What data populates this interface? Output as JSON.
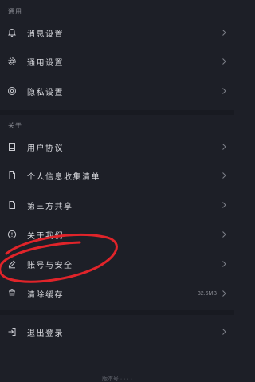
{
  "sections": {
    "general_header": "通用",
    "about_header": "关于"
  },
  "rows": {
    "message_settings": "消息设置",
    "general_settings": "通用设置",
    "privacy_settings": "隐私设置",
    "user_agreement": "用户协议",
    "personal_info_list": "个人信息收集清单",
    "third_party_sharing": "第三方共享",
    "about_us": "关于我们",
    "profile_manage": "账号与安全",
    "clear_cache": "清除缓存",
    "clear_cache_size": "32.6MB",
    "logout": "退出登录"
  },
  "footer": {
    "text": "版本号 · · · ·"
  },
  "icons": {
    "message": "bell-icon",
    "general": "gear-icon",
    "privacy": "settings-circle-icon",
    "agreement": "book-icon",
    "info_list": "document-icon",
    "sharing": "document-icon",
    "about": "info-circle-icon",
    "profile": "pencil-icon",
    "cache": "trash-icon",
    "logout": "logout-icon",
    "chevron": "chevron-right-icon"
  },
  "colors": {
    "background": "#1d1f27",
    "text": "#d8d9de",
    "muted": "#8b8d95",
    "annotation": "#e0242a"
  }
}
